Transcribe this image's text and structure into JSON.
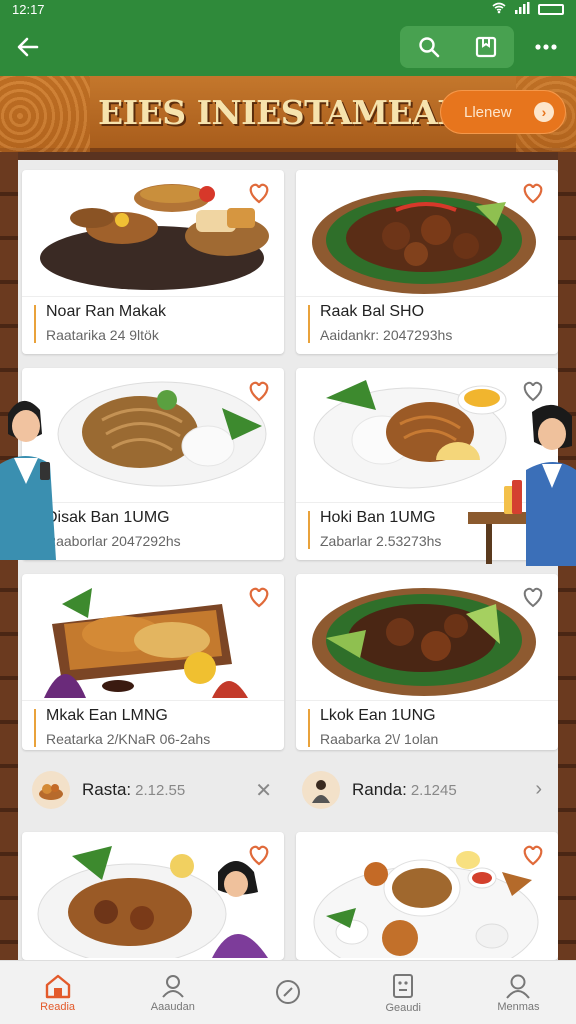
{
  "status_bar": {
    "time": "12:17"
  },
  "header": {
    "back_icon": "arrow-left-icon",
    "actions": [
      "search-icon",
      "bookmark-icon",
      "more-icon"
    ]
  },
  "banner": {
    "title": "EIES INIESTAMEAN",
    "button_label": "Llenew",
    "colors": {
      "banner": "#b96a24",
      "button": "#e7751d",
      "title": "#f6e3ad"
    }
  },
  "cards": [
    {
      "name": "Noar Ran Makak",
      "subtitle": "Raatarika 24 9ltök",
      "liked": false
    },
    {
      "name": "Raak Bal SHO",
      "subtitle": "Aaidankr: 2047293hs",
      "liked": false
    },
    {
      "name": "Disak Ban 1UMG",
      "subtitle": "Raaborlar 2047292hs",
      "liked": false
    },
    {
      "name": "Hoki Ban 1UMG",
      "subtitle": "Zabarlar 2.53273hs",
      "liked": false
    },
    {
      "name": "Mkak Ean LMNG",
      "subtitle": "Reatarka 2/KNaR 06-2ahs",
      "liked": false
    },
    {
      "name": "Lkok Ean 1UNG",
      "subtitle": "Raabarka 2\\/ 1olan",
      "liked": false
    },
    {
      "name": "",
      "subtitle": "",
      "liked": false
    },
    {
      "name": "",
      "subtitle": "",
      "liked": false
    }
  ],
  "ad_row": [
    {
      "label": "Rasta:",
      "value": "2.12.55",
      "control": "close-icon"
    },
    {
      "label": "Randa:",
      "value": "2.1245",
      "control": "chevron-right-icon"
    }
  ],
  "bottom_nav": [
    {
      "label": "Readia",
      "icon": "home-icon",
      "active": true
    },
    {
      "label": "Aaaudan",
      "icon": "profile-icon",
      "active": false
    },
    {
      "label": "",
      "icon": "compass-icon",
      "active": false
    },
    {
      "label": "Geaudi",
      "icon": "receipt-icon",
      "active": false
    },
    {
      "label": "Menmas",
      "icon": "user-icon",
      "active": false
    }
  ],
  "colors": {
    "app_bar": "#2f8a3a",
    "accent": "#e35a2b",
    "heart": "#e06a3a"
  }
}
